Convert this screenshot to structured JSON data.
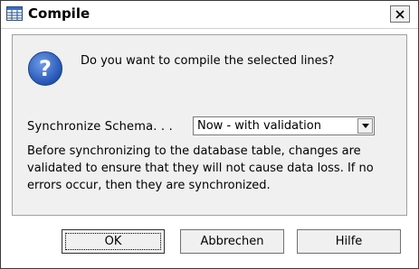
{
  "window": {
    "title": "Compile"
  },
  "dialog": {
    "message": "Do you want to compile the selected lines?",
    "sync_label": "Synchronize Schema. . .",
    "sync_selected": "Now - with validation",
    "description": "Before synchronizing to the database table, changes are validated to ensure that they will not cause data loss. If no errors occur, then they are synchronized."
  },
  "buttons": {
    "ok": "OK",
    "cancel": "Abbrechen",
    "help": "Hilfe"
  },
  "icons": {
    "title": "table-icon",
    "message": "question-icon",
    "close": "close-icon",
    "dropdown": "chevron-down-icon"
  },
  "colors": {
    "question_icon": "#2f5fc4",
    "dialog_background": "#f0f0f0"
  }
}
